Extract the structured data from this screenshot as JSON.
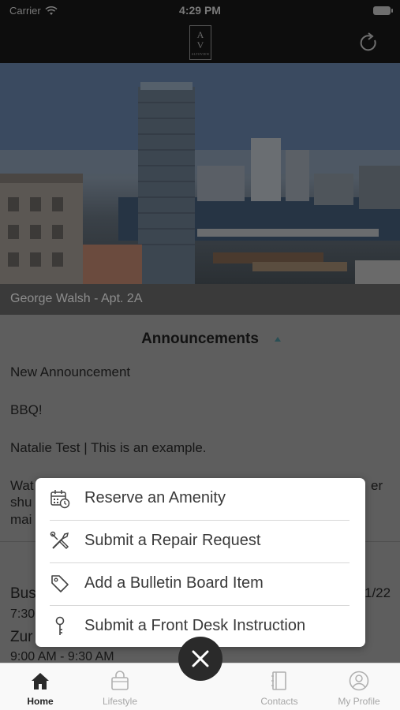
{
  "status_bar": {
    "carrier": "Carrier",
    "time": "4:29 PM"
  },
  "header": {
    "logo_letters": [
      "A",
      "V"
    ],
    "logo_sub": "ALTOVIEW"
  },
  "resident": {
    "label": "George Walsh - Apt. 2A"
  },
  "announcements": {
    "title": "Announcements",
    "items": [
      "New Announcement",
      "BBQ!",
      "Natalie Test | This is an example."
    ],
    "partial_lines": [
      "Wat",
      "shu",
      "mai"
    ],
    "partial_right": "er"
  },
  "events": {
    "line1_left": "Bus",
    "line1_right": "1/22",
    "line2": "7:30",
    "line3": "Zur",
    "line4": "9:00 AM - 9:30 AM"
  },
  "action_menu": {
    "items": [
      {
        "label": "Reserve an Amenity",
        "icon": "calendar-clock-icon"
      },
      {
        "label": "Submit a Repair Request",
        "icon": "tools-icon"
      },
      {
        "label": "Add a Bulletin Board Item",
        "icon": "tag-icon"
      },
      {
        "label": "Submit a Front Desk Instruction",
        "icon": "key-icon"
      }
    ]
  },
  "tab_bar": {
    "tabs": [
      {
        "label": "Home",
        "icon": "home-icon",
        "active": true
      },
      {
        "label": "Lifestyle",
        "icon": "shopping-bag-icon",
        "active": false
      },
      {
        "label": "Contacts",
        "icon": "address-book-icon",
        "active": false
      },
      {
        "label": "My Profile",
        "icon": "profile-icon",
        "active": false
      }
    ],
    "center_action": "close-icon"
  },
  "colors": {
    "accent": "#2a2a2a",
    "menu_bg": "#ffffff",
    "overlay": "#5e5e5e"
  }
}
